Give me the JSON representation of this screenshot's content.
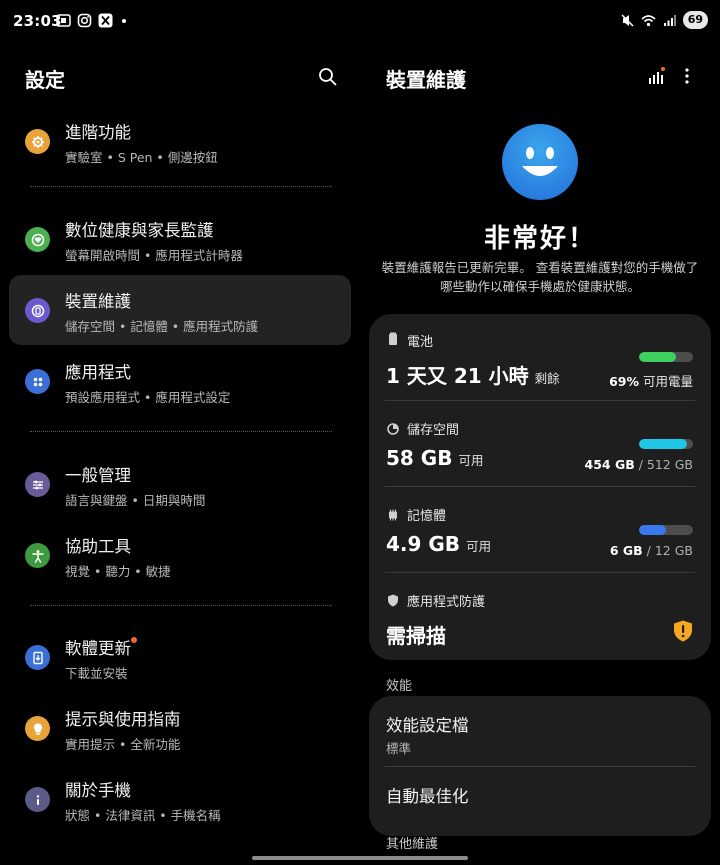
{
  "status_bar": {
    "time": "23:03",
    "battery": "69"
  },
  "left": {
    "title": "設定",
    "items": [
      {
        "title": "進階功能",
        "sub": "實驗室 • S Pen • 側邊按鈕",
        "color": "#e8a33a",
        "icon": "gear-plus-icon"
      },
      {
        "title": "數位健康與家長監護",
        "sub": "螢幕開啟時間 • 應用程式計時器",
        "color": "#4caf50",
        "icon": "heart-circle-icon"
      },
      {
        "title": "裝置維護",
        "sub": "儲存空間 • 記憶體 • 應用程式防護",
        "color": "#6a5acd",
        "icon": "device-care-icon"
      },
      {
        "title": "應用程式",
        "sub": "預設應用程式 • 應用程式設定",
        "color": "#3b6fd6",
        "icon": "apps-grid-icon"
      },
      {
        "title": "一般管理",
        "sub": "語言與鍵盤 • 日期與時間",
        "color": "#6a5a9a",
        "icon": "sliders-icon"
      },
      {
        "title": "協助工具",
        "sub": "視覺 • 聽力 • 敏捷",
        "color": "#3e9a3e",
        "icon": "accessibility-icon"
      },
      {
        "title": "軟體更新",
        "sub": "下載並安裝",
        "color": "#3b6fd6",
        "icon": "software-update-icon"
      },
      {
        "title": "提示與使用指南",
        "sub": "實用提示 • 全新功能",
        "color": "#e8a33a",
        "icon": "lightbulb-icon"
      },
      {
        "title": "關於手機",
        "sub": "狀態 • 法律資訊 • 手機名稱",
        "color": "#5c5a86",
        "icon": "info-icon"
      }
    ]
  },
  "right": {
    "title": "裝置維護",
    "status_title": "非常好！",
    "status_desc": "裝置維護報告已更新完畢。 查看裝置維護對您的手機做了哪些動作以確保手機處於健康狀態。",
    "battery": {
      "label": "電池",
      "value": "1 天又 21 小時",
      "unit": "剩餘",
      "percent_text": "69%",
      "percent_label": "可用電量",
      "level": 0.69,
      "color": "#3fd15e"
    },
    "storage": {
      "label": "儲存空間",
      "value": "58 GB",
      "unit": "可用",
      "used": "454 GB",
      "total": "/ 512 GB",
      "level": 0.89,
      "color": "#1fc6e6"
    },
    "memory": {
      "label": "記憶體",
      "value": "4.9 GB",
      "unit": "可用",
      "used": "6 GB",
      "total": "/ 12 GB",
      "level": 0.5,
      "color": "#3b78f0"
    },
    "protection": {
      "label": "應用程式防護",
      "value": "需掃描",
      "warn_color": "#f5a623"
    },
    "performance_section": "效能",
    "performance_profile": {
      "title": "效能設定檔",
      "sub": "標準"
    },
    "auto_optimize": {
      "title": "自動最佳化"
    },
    "other_section": "其他維護"
  }
}
